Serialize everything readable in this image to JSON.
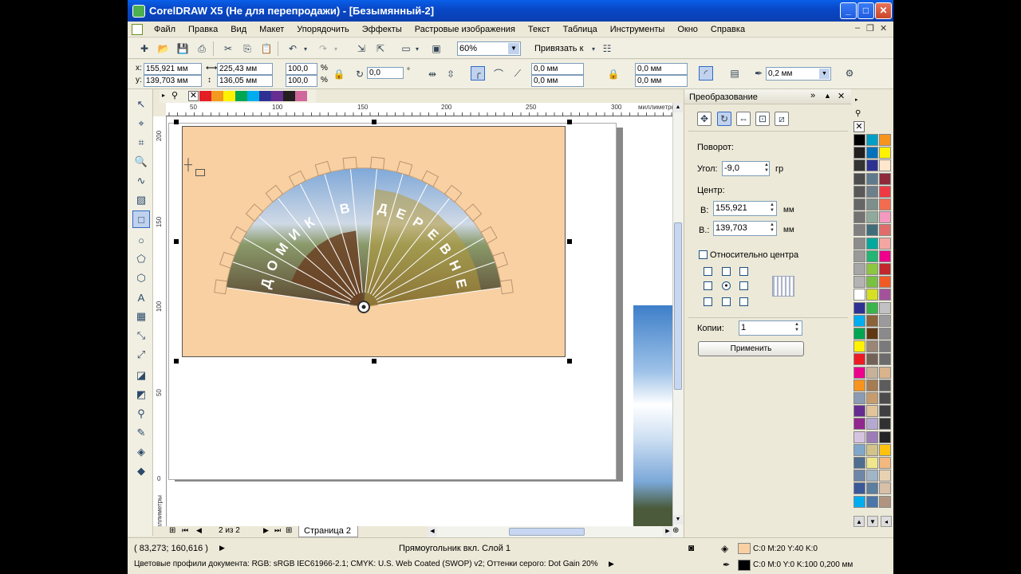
{
  "window": {
    "title": "CorelDRAW X5 (Не для перепродажи) - [Безымянный-2]"
  },
  "menu": [
    "Файл",
    "Правка",
    "Вид",
    "Макет",
    "Упорядочить",
    "Эффекты",
    "Растровые изображения",
    "Текст",
    "Таблица",
    "Инструменты",
    "Окно",
    "Справка"
  ],
  "toolbar": {
    "zoom": "60%",
    "snap_label": "Привязать к"
  },
  "propbar": {
    "x_label": "x:",
    "x": "155,921 мм",
    "y_label": "y:",
    "y": "139,703 мм",
    "width": "225,43 мм",
    "height": "136,05 мм",
    "scale_x": "100,0",
    "scale_y": "100,0",
    "pct": "%",
    "rotation": "0,0",
    "deg": "°",
    "corner_tl": "0,0 мм",
    "corner_bl": "0,0 мм",
    "corner_tr": "0,0 мм",
    "corner_br": "0,0 мм",
    "outline": "0,2 мм"
  },
  "ruler": {
    "h_ticks": [
      "50",
      "100",
      "150",
      "200",
      "250",
      "300"
    ],
    "h_unit": "миллиметры",
    "v_ticks": [
      "200",
      "150",
      "100",
      "50",
      "0"
    ],
    "v_unit": "миллиметры"
  },
  "artwork": {
    "fan_text": [
      "Д",
      "О",
      "М",
      "И",
      "К",
      "",
      "В",
      "",
      "Д",
      "Е",
      "Р",
      "Е",
      "В",
      "Н",
      "Е"
    ],
    "bg_color": "#f9d0a2"
  },
  "page_nav": {
    "count": "2 из 2",
    "tab": "Страница 2"
  },
  "docker": {
    "title": "Преобразование",
    "rotation_label": "Поворот:",
    "angle_label": "Угол:",
    "angle": "-9,0",
    "angle_unit": "гр",
    "center_label": "Центр:",
    "cx_label": "В:",
    "cx": "155,921",
    "cx_unit": "мм",
    "cy_label": "В.:",
    "cy": "139,703",
    "cy_unit": "мм",
    "relative_label": "Относительно центра",
    "copies_label": "Копии:",
    "copies": "1",
    "apply_label": "Применить"
  },
  "palette_colors": [
    "#ffffff",
    "#000000",
    "#e41e26",
    "#f39a1e",
    "#fff200",
    "#00a651",
    "#00aeef",
    "#2e3192",
    "#ec008c",
    "#808080"
  ],
  "status": {
    "coords": "( 83,273; 160,616 )",
    "object_info": "Прямоугольник вкл. Слой 1",
    "fill_info": "C:0 M:20 Y:40 K:0",
    "color_profile": "Цветовые профили документа: RGB: sRGB IEC61966-2.1; CMYK: U.S. Web Coated (SWOP) v2; Оттенки серого: Dot Gain 20%",
    "outline_info": "C:0 M:0 Y:0 K:100  0,200 мм"
  }
}
